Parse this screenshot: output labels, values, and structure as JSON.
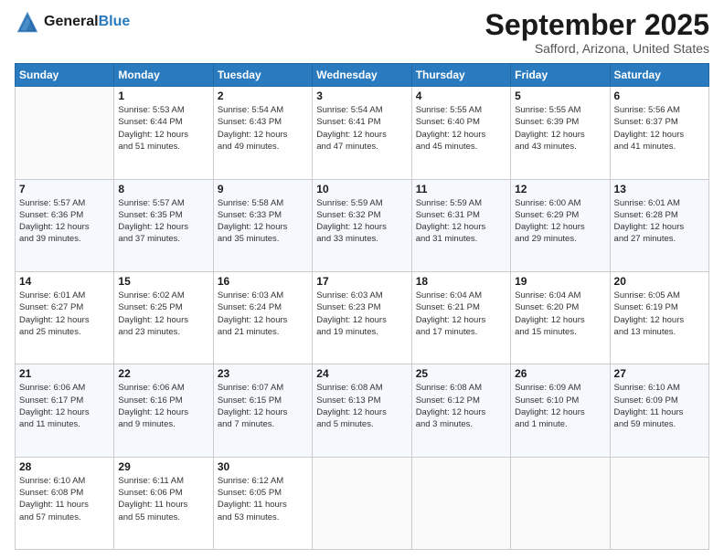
{
  "header": {
    "logo_general": "General",
    "logo_blue": "Blue",
    "month_title": "September 2025",
    "location": "Safford, Arizona, United States"
  },
  "days_of_week": [
    "Sunday",
    "Monday",
    "Tuesday",
    "Wednesday",
    "Thursday",
    "Friday",
    "Saturday"
  ],
  "weeks": [
    [
      {
        "day": "",
        "info": ""
      },
      {
        "day": "1",
        "info": "Sunrise: 5:53 AM\nSunset: 6:44 PM\nDaylight: 12 hours\nand 51 minutes."
      },
      {
        "day": "2",
        "info": "Sunrise: 5:54 AM\nSunset: 6:43 PM\nDaylight: 12 hours\nand 49 minutes."
      },
      {
        "day": "3",
        "info": "Sunrise: 5:54 AM\nSunset: 6:41 PM\nDaylight: 12 hours\nand 47 minutes."
      },
      {
        "day": "4",
        "info": "Sunrise: 5:55 AM\nSunset: 6:40 PM\nDaylight: 12 hours\nand 45 minutes."
      },
      {
        "day": "5",
        "info": "Sunrise: 5:55 AM\nSunset: 6:39 PM\nDaylight: 12 hours\nand 43 minutes."
      },
      {
        "day": "6",
        "info": "Sunrise: 5:56 AM\nSunset: 6:37 PM\nDaylight: 12 hours\nand 41 minutes."
      }
    ],
    [
      {
        "day": "7",
        "info": "Sunrise: 5:57 AM\nSunset: 6:36 PM\nDaylight: 12 hours\nand 39 minutes."
      },
      {
        "day": "8",
        "info": "Sunrise: 5:57 AM\nSunset: 6:35 PM\nDaylight: 12 hours\nand 37 minutes."
      },
      {
        "day": "9",
        "info": "Sunrise: 5:58 AM\nSunset: 6:33 PM\nDaylight: 12 hours\nand 35 minutes."
      },
      {
        "day": "10",
        "info": "Sunrise: 5:59 AM\nSunset: 6:32 PM\nDaylight: 12 hours\nand 33 minutes."
      },
      {
        "day": "11",
        "info": "Sunrise: 5:59 AM\nSunset: 6:31 PM\nDaylight: 12 hours\nand 31 minutes."
      },
      {
        "day": "12",
        "info": "Sunrise: 6:00 AM\nSunset: 6:29 PM\nDaylight: 12 hours\nand 29 minutes."
      },
      {
        "day": "13",
        "info": "Sunrise: 6:01 AM\nSunset: 6:28 PM\nDaylight: 12 hours\nand 27 minutes."
      }
    ],
    [
      {
        "day": "14",
        "info": "Sunrise: 6:01 AM\nSunset: 6:27 PM\nDaylight: 12 hours\nand 25 minutes."
      },
      {
        "day": "15",
        "info": "Sunrise: 6:02 AM\nSunset: 6:25 PM\nDaylight: 12 hours\nand 23 minutes."
      },
      {
        "day": "16",
        "info": "Sunrise: 6:03 AM\nSunset: 6:24 PM\nDaylight: 12 hours\nand 21 minutes."
      },
      {
        "day": "17",
        "info": "Sunrise: 6:03 AM\nSunset: 6:23 PM\nDaylight: 12 hours\nand 19 minutes."
      },
      {
        "day": "18",
        "info": "Sunrise: 6:04 AM\nSunset: 6:21 PM\nDaylight: 12 hours\nand 17 minutes."
      },
      {
        "day": "19",
        "info": "Sunrise: 6:04 AM\nSunset: 6:20 PM\nDaylight: 12 hours\nand 15 minutes."
      },
      {
        "day": "20",
        "info": "Sunrise: 6:05 AM\nSunset: 6:19 PM\nDaylight: 12 hours\nand 13 minutes."
      }
    ],
    [
      {
        "day": "21",
        "info": "Sunrise: 6:06 AM\nSunset: 6:17 PM\nDaylight: 12 hours\nand 11 minutes."
      },
      {
        "day": "22",
        "info": "Sunrise: 6:06 AM\nSunset: 6:16 PM\nDaylight: 12 hours\nand 9 minutes."
      },
      {
        "day": "23",
        "info": "Sunrise: 6:07 AM\nSunset: 6:15 PM\nDaylight: 12 hours\nand 7 minutes."
      },
      {
        "day": "24",
        "info": "Sunrise: 6:08 AM\nSunset: 6:13 PM\nDaylight: 12 hours\nand 5 minutes."
      },
      {
        "day": "25",
        "info": "Sunrise: 6:08 AM\nSunset: 6:12 PM\nDaylight: 12 hours\nand 3 minutes."
      },
      {
        "day": "26",
        "info": "Sunrise: 6:09 AM\nSunset: 6:10 PM\nDaylight: 12 hours\nand 1 minute."
      },
      {
        "day": "27",
        "info": "Sunrise: 6:10 AM\nSunset: 6:09 PM\nDaylight: 11 hours\nand 59 minutes."
      }
    ],
    [
      {
        "day": "28",
        "info": "Sunrise: 6:10 AM\nSunset: 6:08 PM\nDaylight: 11 hours\nand 57 minutes."
      },
      {
        "day": "29",
        "info": "Sunrise: 6:11 AM\nSunset: 6:06 PM\nDaylight: 11 hours\nand 55 minutes."
      },
      {
        "day": "30",
        "info": "Sunrise: 6:12 AM\nSunset: 6:05 PM\nDaylight: 11 hours\nand 53 minutes."
      },
      {
        "day": "",
        "info": ""
      },
      {
        "day": "",
        "info": ""
      },
      {
        "day": "",
        "info": ""
      },
      {
        "day": "",
        "info": ""
      }
    ]
  ]
}
